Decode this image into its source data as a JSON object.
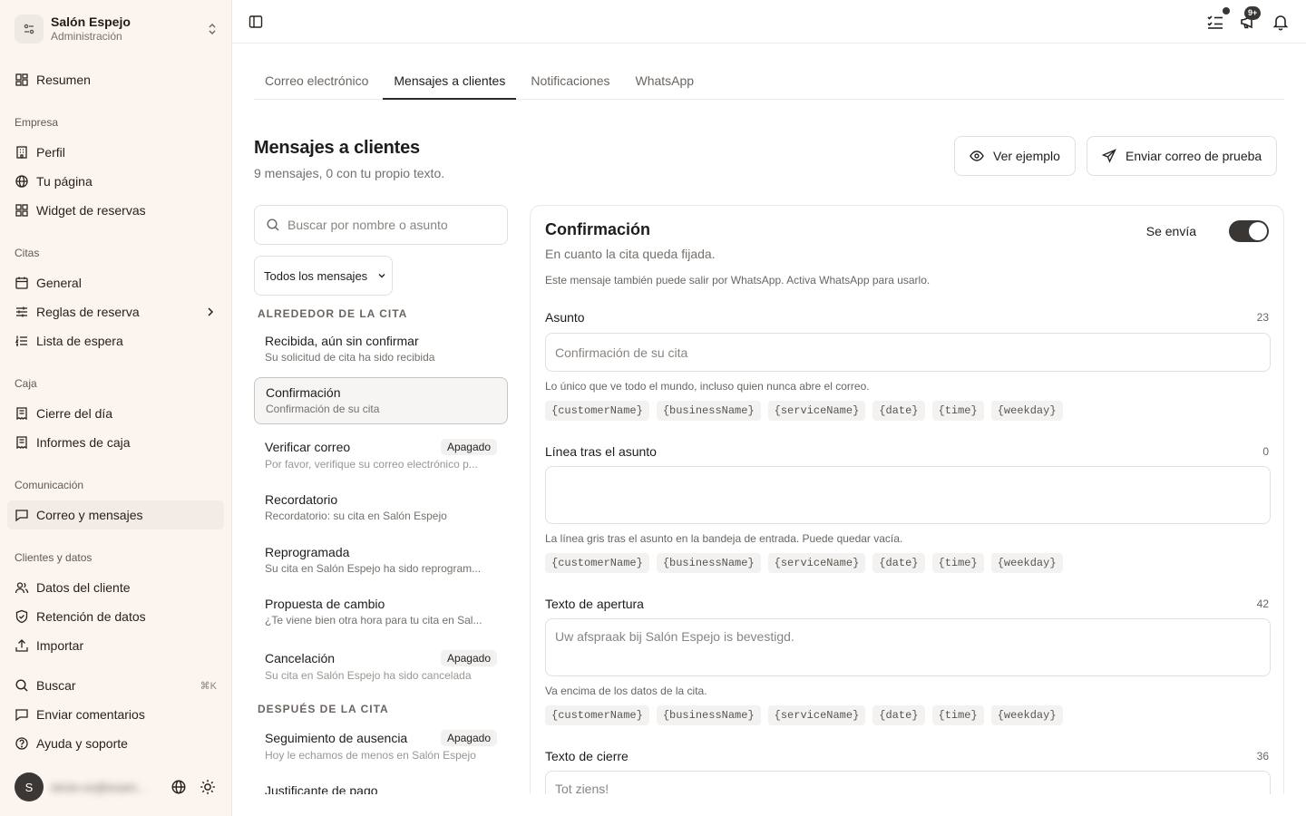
{
  "brand": {
    "name": "Salón Espejo",
    "subtitle": "Administración"
  },
  "nav": {
    "overview": "Resumen",
    "sections": {
      "business": "Empresa",
      "appointments": "Citas",
      "cash": "Caja",
      "communication": "Comunicación",
      "clients": "Clientes y datos"
    },
    "items": {
      "profile": "Perfil",
      "page": "Tu página",
      "widget": "Widget de reservas",
      "general": "General",
      "rules": "Reglas de reserva",
      "waitlist": "Lista de espera",
      "closing": "Cierre del día",
      "reports": "Informes de caja",
      "email": "Correo y mensajes",
      "clientdata": "Datos del cliente",
      "retention": "Retención de datos",
      "import": "Importar",
      "search": "Buscar",
      "feedback": "Enviar comentarios",
      "help": "Ayuda y soporte"
    },
    "search_shortcut": "⌘K"
  },
  "user": {
    "initial": "S",
    "email": "stroix-os@exam..."
  },
  "topbar": {
    "badge": "9+"
  },
  "tabs": [
    "Correo electrónico",
    "Mensajes a clientes",
    "Notificaciones",
    "WhatsApp"
  ],
  "header": {
    "title": "Mensajes a clientes",
    "subtitle": "9 mensajes, 0 con tu propio texto.",
    "preview_button": "Ver ejemplo",
    "test_button": "Enviar correo de prueba"
  },
  "list": {
    "search_placeholder": "Buscar por nombre o asunto",
    "filter": "Todos los mensajes",
    "off_label": "Apagado",
    "group_around": "ALREDEDOR DE LA CITA",
    "group_after": "DESPUÉS DE LA CITA",
    "messages": [
      {
        "name": "Recibida, aún sin confirmar",
        "subject": "Su solicitud de cita ha sido recibida"
      },
      {
        "name": "Confirmación",
        "subject": "Confirmación de su cita"
      },
      {
        "name": "Verificar correo",
        "subject": "Por favor, verifique su correo electrónico p..."
      },
      {
        "name": "Recordatorio",
        "subject": "Recordatorio: su cita en Salón Espejo"
      },
      {
        "name": "Reprogramada",
        "subject": "Su cita en Salón Espejo ha sido reprogram..."
      },
      {
        "name": "Propuesta de cambio",
        "subject": "¿Te viene bien otra hora para tu cita en Sal..."
      },
      {
        "name": "Cancelación",
        "subject": "Su cita en Salón Espejo ha sido cancelada"
      },
      {
        "name": "Seguimiento de ausencia",
        "subject": "Hoy le echamos de menos en Salón Espejo"
      },
      {
        "name": "Justificante de pago",
        "subject": ""
      }
    ]
  },
  "editor": {
    "title": "Confirmación",
    "description": "En cuanto la cita queda fijada.",
    "note": "Este mensaje también puede salir por WhatsApp. Activa WhatsApp para usarlo.",
    "send_label": "Se envía",
    "tokens": [
      "{customerName}",
      "{businessName}",
      "{serviceName}",
      "{date}",
      "{time}",
      "{weekday}"
    ],
    "subject": {
      "label": "Asunto",
      "count": "23",
      "placeholder": "Confirmación de su cita",
      "help": "Lo único que ve todo el mundo, incluso quien nunca abre el correo."
    },
    "preheader": {
      "label": "Línea tras el asunto",
      "count": "0",
      "placeholder": "",
      "help": "La línea gris tras el asunto en la bandeja de entrada. Puede quedar vacía."
    },
    "opening": {
      "label": "Texto de apertura",
      "count": "42",
      "placeholder": "Uw afspraak bij Salón Espejo is bevestigd.",
      "help": "Va encima de los datos de la cita."
    },
    "closing": {
      "label": "Texto de cierre",
      "count": "36",
      "placeholder": "Tot ziens!"
    }
  }
}
